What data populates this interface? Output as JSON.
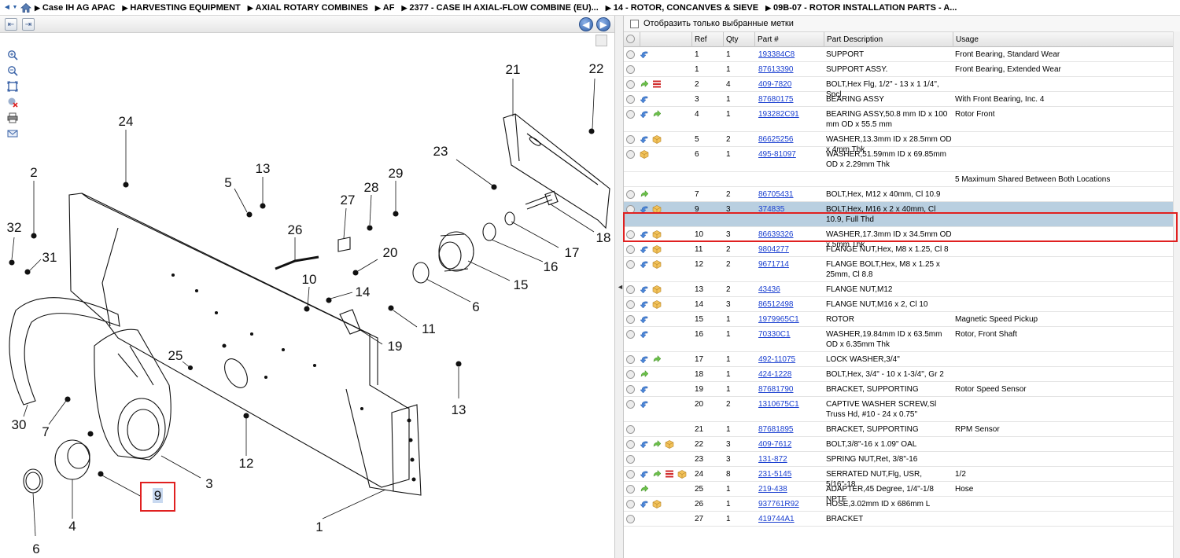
{
  "breadcrumb": {
    "items": [
      "Case IH AG APAC",
      "HARVESTING EQUIPMENT",
      "AXIAL ROTARY COMBINES",
      "AF",
      "2377 - CASE IH AXIAL-FLOW COMBINE (EU)...",
      "14 - ROTOR, CONCANVES & SIEVE",
      "09B-07 - ROTOR INSTALLATION PARTS - A..."
    ]
  },
  "diagram": {
    "callouts": [
      "24",
      "2",
      "32",
      "31",
      "13",
      "5",
      "26",
      "27",
      "28",
      "29",
      "20",
      "10",
      "14",
      "19",
      "11",
      "25",
      "7",
      "30",
      "9",
      "4",
      "6",
      "3",
      "12",
      "1",
      "23",
      "21",
      "22",
      "18",
      "17",
      "16",
      "15",
      "6",
      "13"
    ],
    "selected_callout": "9"
  },
  "filter": {
    "label": "Отобразить только выбранные метки"
  },
  "columns": {
    "ref": "Ref",
    "qty": "Qty",
    "part": "Part #",
    "desc": "Part Description",
    "usage": "Usage"
  },
  "colors": {
    "selected_row": "#b9cfe0",
    "highlight_box": "#e02020",
    "link": "#1a3fd0"
  },
  "rows": [
    {
      "ref": "1",
      "qty": "1",
      "part": "193384C8",
      "desc": "SUPPORT",
      "usage": "Front Bearing, Standard Wear",
      "icons": [
        "plus",
        "blue-arrow"
      ]
    },
    {
      "ref": "1",
      "qty": "1",
      "part": "87613390",
      "desc": "SUPPORT ASSY.",
      "usage": "Front Bearing, Extended Wear",
      "icons": [
        "plus"
      ]
    },
    {
      "ref": "2",
      "qty": "4",
      "part": "409-7820",
      "desc": "BOLT,Hex Flg, 1/2\" - 13 x 1 1/4\", Spcl",
      "usage": "",
      "icons": [
        "plus",
        "green-arrow",
        "red-list"
      ]
    },
    {
      "ref": "3",
      "qty": "1",
      "part": "87680175",
      "desc": "BEARING ASSY",
      "usage": "With Front Bearing, Inc. 4",
      "icons": [
        "plus",
        "blue-arrow"
      ]
    },
    {
      "ref": "4",
      "qty": "1",
      "part": "193282C91",
      "desc": "BEARING ASSY,50.8 mm ID x 100 mm OD x 55.5 mm",
      "usage": "Rotor Front",
      "icons": [
        "plus",
        "blue-arrow",
        "green-arrow"
      ]
    },
    {
      "ref": "5",
      "qty": "2",
      "part": "86625256",
      "desc": "WASHER,13.3mm ID x 28.5mm OD x 4mm Thk",
      "usage": "",
      "icons": [
        "plus",
        "blue-arrow",
        "box"
      ]
    },
    {
      "ref": "6",
      "qty": "1",
      "part": "495-81097",
      "desc": "WASHER,51.59mm ID x 69.85mm OD x 2.29mm Thk",
      "usage": "",
      "icons": [
        "plus",
        "box"
      ]
    },
    {
      "ref": "",
      "qty": "",
      "part": "",
      "desc": "",
      "usage": "5 Maximum Shared Between Both Locations",
      "icons": []
    },
    {
      "ref": "7",
      "qty": "2",
      "part": "86705431",
      "desc": "BOLT,Hex, M12 x 40mm, Cl 10.9",
      "usage": "",
      "icons": [
        "plus",
        "green-arrow"
      ]
    },
    {
      "ref": "9",
      "qty": "3",
      "part": "374835",
      "desc": "BOLT,Hex, M16 x 2 x 40mm, Cl 10.9, Full Thd",
      "usage": "",
      "icons": [
        "plus",
        "blue-arrow",
        "box"
      ],
      "selected": true
    },
    {
      "ref": "10",
      "qty": "3",
      "part": "86639326",
      "desc": "WASHER,17.3mm ID x 34.5mm OD x 5mm Thk",
      "usage": "",
      "icons": [
        "plus",
        "blue-arrow",
        "box"
      ]
    },
    {
      "ref": "11",
      "qty": "2",
      "part": "9804277",
      "desc": "FLANGE NUT,Hex, M8 x 1.25, Cl 8",
      "usage": "",
      "icons": [
        "plus",
        "blue-arrow",
        "box"
      ]
    },
    {
      "ref": "12",
      "qty": "2",
      "part": "9671714",
      "desc": "FLANGE BOLT,Hex, M8 x 1.25 x 25mm, Cl 8.8",
      "usage": "",
      "icons": [
        "plus",
        "blue-arrow",
        "box"
      ]
    },
    {
      "ref": "13",
      "qty": "2",
      "part": "43436",
      "desc": "FLANGE NUT,M12",
      "usage": "",
      "icons": [
        "plus",
        "blue-arrow",
        "box"
      ]
    },
    {
      "ref": "14",
      "qty": "3",
      "part": "86512498",
      "desc": "FLANGE NUT,M16 x 2, Cl 10",
      "usage": "",
      "icons": [
        "plus",
        "blue-arrow",
        "box"
      ]
    },
    {
      "ref": "15",
      "qty": "1",
      "part": "1979965C1",
      "desc": "ROTOR",
      "usage": "Magnetic Speed Pickup",
      "icons": [
        "plus",
        "blue-arrow"
      ]
    },
    {
      "ref": "16",
      "qty": "1",
      "part": "70330C1",
      "desc": "WASHER,19.84mm ID x 63.5mm OD x 6.35mm Thk",
      "usage": "Rotor, Front Shaft",
      "icons": [
        "plus",
        "blue-arrow"
      ]
    },
    {
      "ref": "17",
      "qty": "1",
      "part": "492-11075",
      "desc": "LOCK WASHER,3/4\"",
      "usage": "",
      "icons": [
        "plus",
        "blue-arrow",
        "green-arrow"
      ]
    },
    {
      "ref": "18",
      "qty": "1",
      "part": "424-1228",
      "desc": "BOLT,Hex, 3/4\" - 10 x 1-3/4\", Gr 2",
      "usage": "",
      "icons": [
        "plus",
        "green-arrow"
      ]
    },
    {
      "ref": "19",
      "qty": "1",
      "part": "87681790",
      "desc": "BRACKET, SUPPORTING",
      "usage": "Rotor Speed Sensor",
      "icons": [
        "plus",
        "blue-arrow"
      ]
    },
    {
      "ref": "20",
      "qty": "2",
      "part": "1310675C1",
      "desc": "CAPTIVE WASHER SCREW,Sl Truss Hd, #10 - 24 x 0.75\"",
      "usage": "",
      "icons": [
        "plus",
        "blue-arrow"
      ]
    },
    {
      "ref": "21",
      "qty": "1",
      "part": "87681895",
      "desc": "BRACKET, SUPPORTING",
      "usage": "RPM Sensor",
      "icons": [
        "plus"
      ]
    },
    {
      "ref": "22",
      "qty": "3",
      "part": "409-7612",
      "desc": "BOLT,3/8\"-16 x 1.09\" OAL",
      "usage": "",
      "icons": [
        "plus",
        "blue-arrow",
        "green-arrow",
        "box"
      ]
    },
    {
      "ref": "23",
      "qty": "3",
      "part": "131-872",
      "desc": "SPRING NUT,Ret, 3/8\"-16",
      "usage": "",
      "icons": [
        "plus"
      ]
    },
    {
      "ref": "24",
      "qty": "8",
      "part": "231-5145",
      "desc": "SERRATED NUT,Flg, USR, 5/16\"-18",
      "usage": "1/2",
      "icons": [
        "plus",
        "blue-arrow",
        "green-arrow",
        "red-list",
        "box"
      ]
    },
    {
      "ref": "25",
      "qty": "1",
      "part": "219-438",
      "desc": "ADAPTER,45 Degree, 1/4\"-1/8 NPTF",
      "usage": "Hose",
      "icons": [
        "plus",
        "green-arrow"
      ]
    },
    {
      "ref": "26",
      "qty": "1",
      "part": "937761R92",
      "desc": "HOSE,3.02mm ID x 686mm L",
      "usage": "",
      "icons": [
        "plus",
        "blue-arrow",
        "box"
      ]
    },
    {
      "ref": "27",
      "qty": "1",
      "part": "419744A1",
      "desc": "BRACKET",
      "usage": "",
      "icons": [
        "plus"
      ]
    }
  ]
}
